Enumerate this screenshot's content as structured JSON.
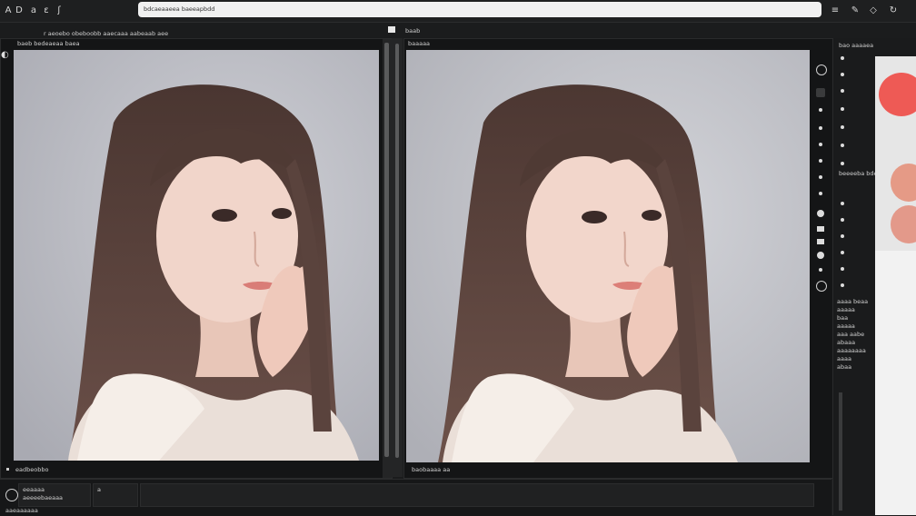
{
  "colors": {
    "accent_red": "#ee5a55",
    "accent_peach": "#e59a86",
    "background": "#1b1c1d"
  },
  "address_bar": {
    "text": "bdcaeaaeea baeeapbdd"
  },
  "top_icons": [
    "a-glyph",
    "b-glyph",
    "a-glyph",
    "back-icon"
  ],
  "toolbar_right": {
    "menu_icon": "≡",
    "brush_icon": "✎",
    "eraser_icon": "◇",
    "refresh_icon": "↻"
  },
  "subheader": {
    "left_text": "r aeoebo obeboobb aaecaaa aabeaab aee",
    "right_text": "baab"
  },
  "left_panel": {
    "title": "baeb bedeaeaa baea",
    "footer_text": "eadbeobbo"
  },
  "right_panel": {
    "title": "baaaaa",
    "footer_text": "baobaaaa aa"
  },
  "dock": {
    "header": "bao aaaaea",
    "section_label": "beeeeba bde",
    "list": [
      "aaaa beaa",
      "aaaaa",
      "baa",
      "aaaaa",
      "aaa aabe",
      "abaaa",
      "aaaaaaaa",
      "aaaa",
      "abaa"
    ]
  },
  "bottom": {
    "field1_line1": "eeaaaa",
    "field1_line2": "aeeeebaeaaa",
    "field2": "a",
    "status": "aaeaaaaaa"
  }
}
